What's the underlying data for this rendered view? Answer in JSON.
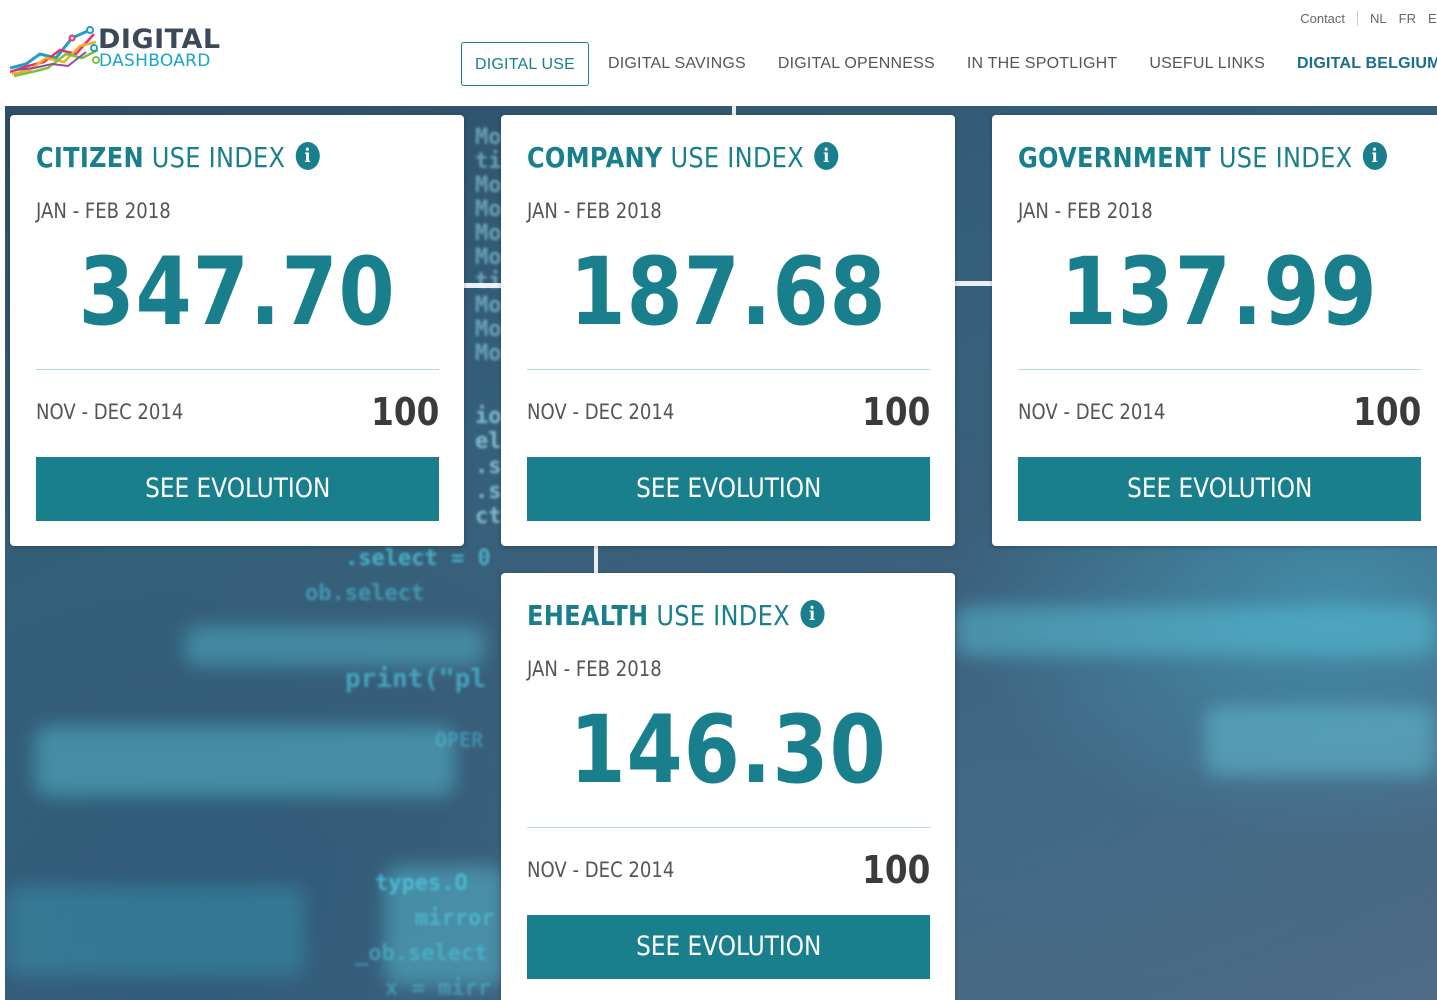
{
  "header": {
    "logo": {
      "line1": "DIGITAL",
      "line2": "DASHBOARD"
    },
    "top_links": {
      "contact": "Contact",
      "languages": [
        "NL",
        "FR",
        "E"
      ]
    },
    "nav": [
      {
        "label": "DIGITAL USE",
        "active": true
      },
      {
        "label": "DIGITAL SAVINGS"
      },
      {
        "label": "DIGITAL OPENNESS"
      },
      {
        "label": "IN THE SPOTLIGHT"
      },
      {
        "label": "USEFUL LINKS"
      },
      {
        "label": "DIGITAL BELGIUM"
      }
    ]
  },
  "hero_code": [
    ".select = 0",
    "ob.select",
    "print(\"pl",
    "OPER",
    "types.O",
    "mirror",
    "_ob.select",
    "x = mirr"
  ],
  "cards": [
    {
      "title_bold": "CITIZEN",
      "title_light": "USE INDEX",
      "info_icon": "i",
      "period": "JAN - FEB 2018",
      "value": "347.70",
      "base_period": "NOV - DEC 2014",
      "base_value": "100",
      "button": "SEE EVOLUTION"
    },
    {
      "title_bold": "COMPANY",
      "title_light": "USE INDEX",
      "info_icon": "i",
      "period": "JAN - FEB 2018",
      "value": "187.68",
      "base_period": "NOV - DEC 2014",
      "base_value": "100",
      "button": "SEE EVOLUTION"
    },
    {
      "title_bold": "GOVERNMENT",
      "title_light": "USE INDEX",
      "info_icon": "i",
      "period": "JAN - FEB 2018",
      "value": "137.99",
      "base_period": "NOV - DEC 2014",
      "base_value": "100",
      "button": "SEE EVOLUTION"
    },
    {
      "title_bold": "EHEALTH",
      "title_light": "USE INDEX",
      "info_icon": "i",
      "period": "JAN - FEB 2018",
      "value": "146.30",
      "base_period": "NOV - DEC 2014",
      "base_value": "100",
      "button": "SEE EVOLUTION"
    }
  ],
  "colors": {
    "accent": "#197f8c",
    "logo_dark": "#3b4a58",
    "logo_light": "#14a7c9",
    "nav_highlight": "#1a6d8f"
  }
}
